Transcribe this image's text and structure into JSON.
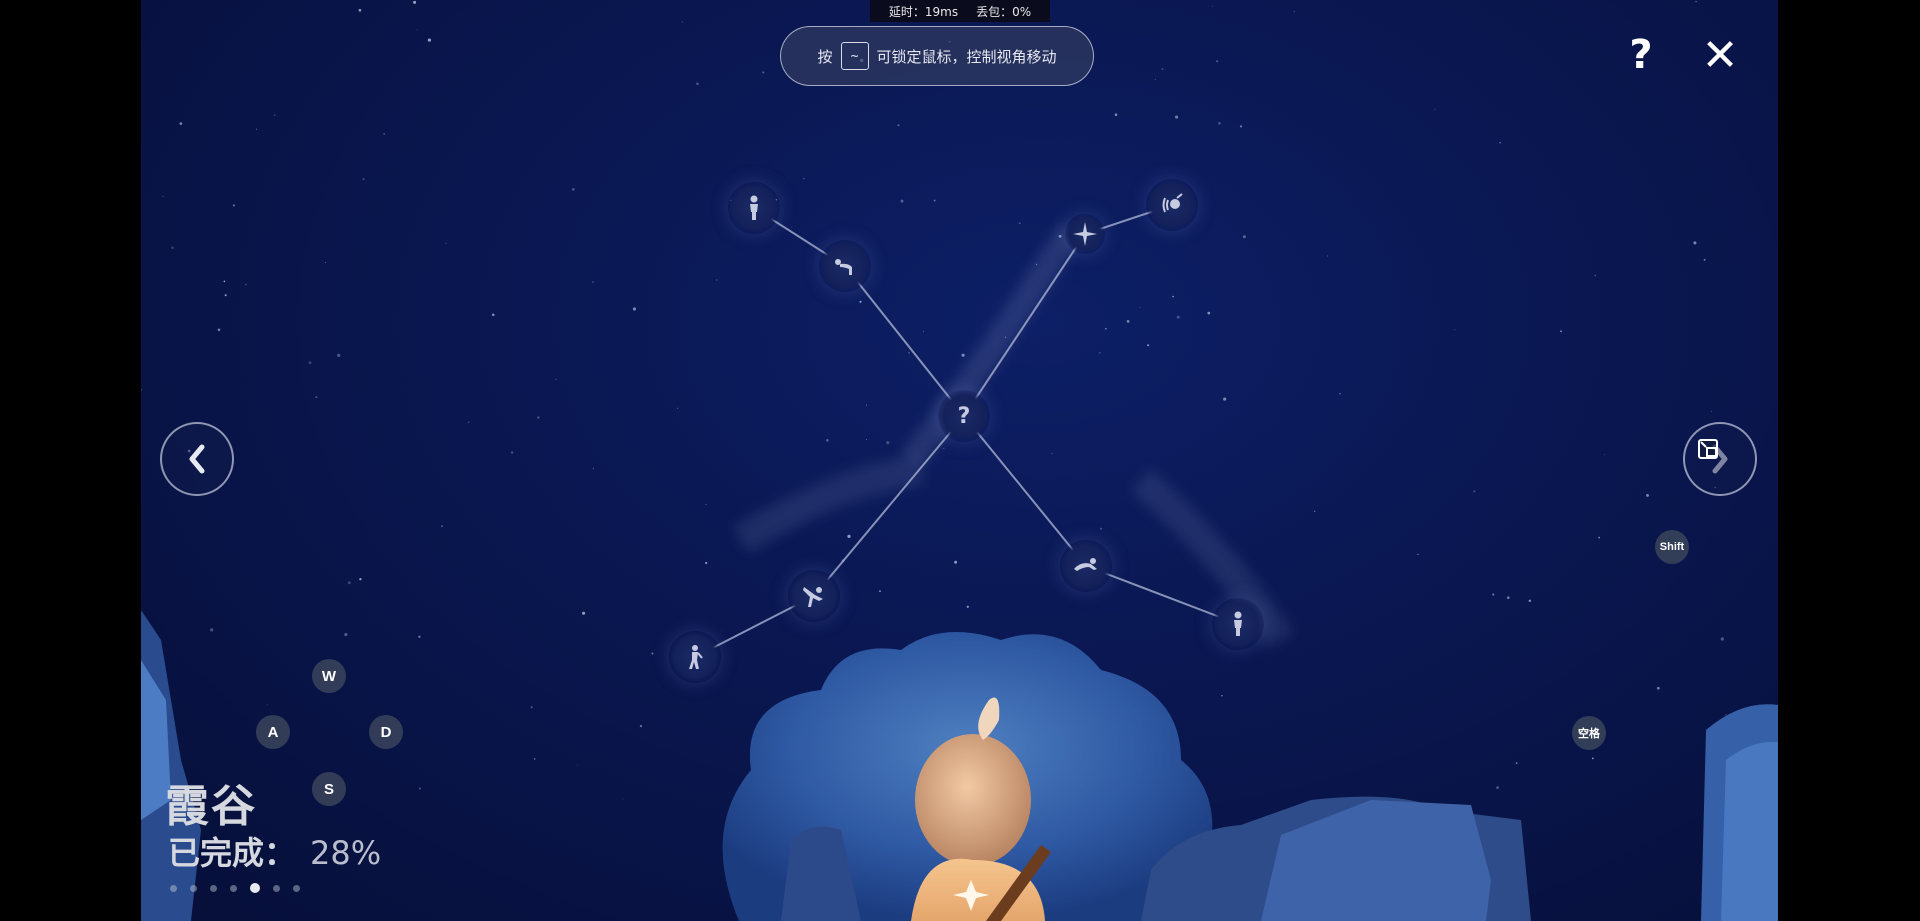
{
  "status_bar": {
    "latency_label": "延时：19ms",
    "packet_loss_label": "丢包：0%"
  },
  "hint": {
    "prefix": "按",
    "key": "~",
    "text": "可锁定鼠标，控制视角移动"
  },
  "top_buttons": {
    "help": "?",
    "close": "✕"
  },
  "constellation": {
    "center_symbol": "?",
    "nodes": [
      "standing-figure-icon",
      "bow-emote-icon",
      "star-node-icon",
      "wave-emote-icon",
      "mystery-spirit-icon",
      "dance-emote-icon",
      "leap-emote-icon",
      "standing-figure-icon",
      "stretch-emote-icon"
    ]
  },
  "controls": {
    "w": "W",
    "a": "A",
    "s": "S",
    "d": "D",
    "shift": "Shift",
    "space": "空格"
  },
  "realm": {
    "name": "霞谷",
    "progress_label": "已完成：",
    "progress_value": "28%",
    "progress_fraction": 0.28
  },
  "pagination": {
    "count": 7,
    "active_index": 4
  }
}
